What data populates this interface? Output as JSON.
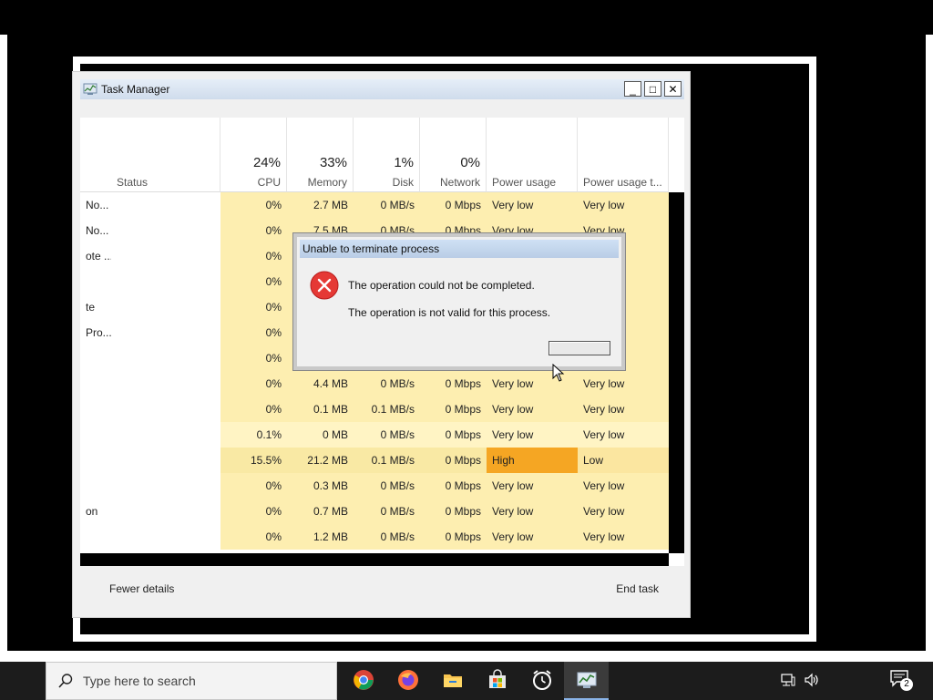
{
  "task_manager": {
    "title": "Task Manager",
    "controls": {
      "minimize": "_",
      "maximize": "□",
      "close": "✕"
    },
    "columns": [
      {
        "label": "Status",
        "pct": ""
      },
      {
        "label": "CPU",
        "pct": "24%"
      },
      {
        "label": "Memory",
        "pct": "33%"
      },
      {
        "label": "Disk",
        "pct": "1%"
      },
      {
        "label": "Network",
        "pct": "0%"
      },
      {
        "label": "Power usage",
        "pct": ""
      },
      {
        "label": "Power usage t...",
        "pct": ""
      }
    ],
    "rows": [
      {
        "name": "No...",
        "cpu": "0%",
        "memory": "2.7 MB",
        "disk": "0 MB/s",
        "network": "0 Mbps",
        "power": "Very low",
        "power_trend": "Very low"
      },
      {
        "name": "No...",
        "cpu": "0%",
        "memory": "7.5 MB",
        "disk": "0 MB/s",
        "network": "0 Mbps",
        "power": "Very low",
        "power_trend": "Very low"
      },
      {
        "name": "ote ...",
        "cpu": "0%",
        "memory": "",
        "disk": "",
        "network": "",
        "power": "",
        "power_trend": ""
      },
      {
        "name": "",
        "cpu": "0%",
        "memory": "",
        "disk": "",
        "network": "",
        "power": "",
        "power_trend": ""
      },
      {
        "name": "te",
        "cpu": "0%",
        "memory": "",
        "disk": "",
        "network": "",
        "power": "",
        "power_trend": ""
      },
      {
        "name": "Pro...",
        "cpu": "0%",
        "memory": "",
        "disk": "",
        "network": "",
        "power": "",
        "power_trend": ""
      },
      {
        "name": "",
        "cpu": "0%",
        "memory": "",
        "disk": "",
        "network": "",
        "power": "",
        "power_trend": ""
      },
      {
        "name": "",
        "cpu": "0%",
        "memory": "4.4 MB",
        "disk": "0 MB/s",
        "network": "0 Mbps",
        "power": "Very low",
        "power_trend": "Very low"
      },
      {
        "name": "",
        "cpu": "0%",
        "memory": "0.1 MB",
        "disk": "0.1 MB/s",
        "network": "0 Mbps",
        "power": "Very low",
        "power_trend": "Very low"
      },
      {
        "name": "",
        "cpu": "0.1%",
        "memory": "0 MB",
        "disk": "0 MB/s",
        "network": "0 Mbps",
        "power": "Very low",
        "power_trend": "Very low"
      },
      {
        "name": "",
        "cpu": "15.5%",
        "memory": "21.2 MB",
        "disk": "0.1 MB/s",
        "network": "0 Mbps",
        "power": "High",
        "power_trend": "Low"
      },
      {
        "name": "",
        "cpu": "0%",
        "memory": "0.3 MB",
        "disk": "0 MB/s",
        "network": "0 Mbps",
        "power": "Very low",
        "power_trend": "Very low"
      },
      {
        "name": "on",
        "cpu": "0%",
        "memory": "0.7 MB",
        "disk": "0 MB/s",
        "network": "0 Mbps",
        "power": "Very low",
        "power_trend": "Very low"
      },
      {
        "name": "",
        "cpu": "0%",
        "memory": "1.2 MB",
        "disk": "0 MB/s",
        "network": "0 Mbps",
        "power": "Very low",
        "power_trend": "Very low"
      }
    ],
    "footer": {
      "fewer_details": "Fewer details",
      "end_task": "End task"
    },
    "colors": {
      "heat_light": "#fff4c4",
      "heat_medium": "#fdeeb0",
      "heat_high": "#f9e9a4",
      "power_high": "#f5a623",
      "power_low_bg": "#fbe6a0"
    }
  },
  "dialog": {
    "title": "Unable to terminate process",
    "message": "The operation could not be completed.",
    "detail": "The operation is not valid for this process.",
    "button_label": "",
    "icon": "error-icon"
  },
  "taskbar": {
    "search_placeholder": "Type here to search",
    "apps": [
      "chrome-icon",
      "firefox-icon",
      "file-explorer-icon",
      "store-icon",
      "clock-icon",
      "task-manager-icon"
    ],
    "notification_count": "2"
  }
}
